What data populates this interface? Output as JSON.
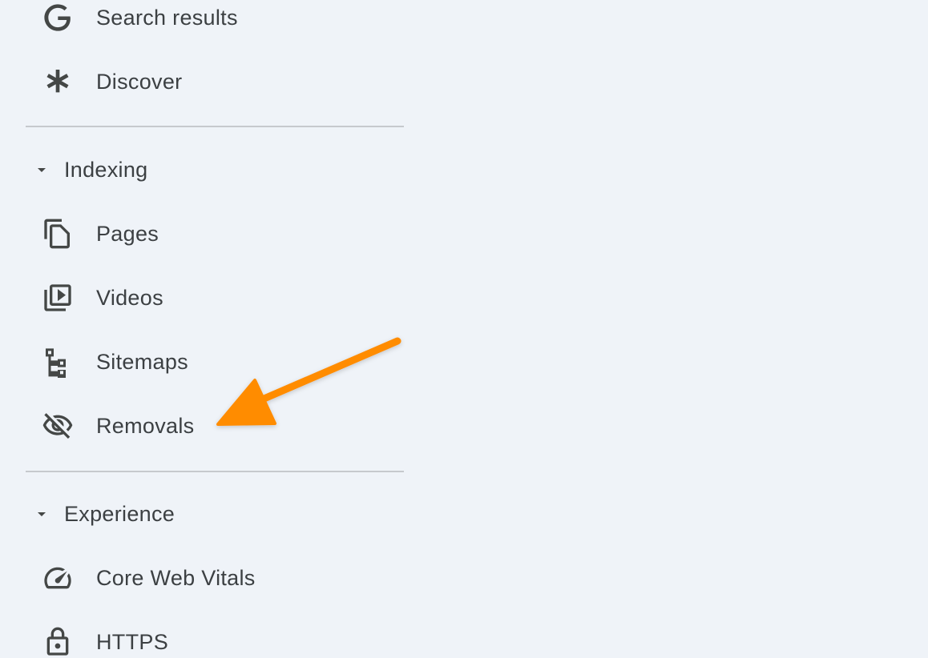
{
  "sidebar": {
    "top_items": [
      {
        "label": "Search results",
        "icon": "google-g-icon"
      },
      {
        "label": "Discover",
        "icon": "asterisk-icon"
      }
    ],
    "sections": [
      {
        "title": "Indexing",
        "expanded": true,
        "items": [
          {
            "label": "Pages",
            "icon": "pages-icon"
          },
          {
            "label": "Videos",
            "icon": "video-library-icon"
          },
          {
            "label": "Sitemaps",
            "icon": "sitemap-icon"
          },
          {
            "label": "Removals",
            "icon": "visibility-off-icon"
          }
        ]
      },
      {
        "title": "Experience",
        "expanded": true,
        "items": [
          {
            "label": "Core Web Vitals",
            "icon": "speed-gauge-icon"
          },
          {
            "label": "HTTPS",
            "icon": "lock-icon"
          }
        ]
      }
    ]
  },
  "annotation": {
    "type": "arrow",
    "color": "#ff8c00",
    "points_to": "Removals"
  },
  "colors": {
    "background": "#eff3f8",
    "text": "#3c4043",
    "icon": "#444746",
    "divider": "#c6c9cd"
  }
}
